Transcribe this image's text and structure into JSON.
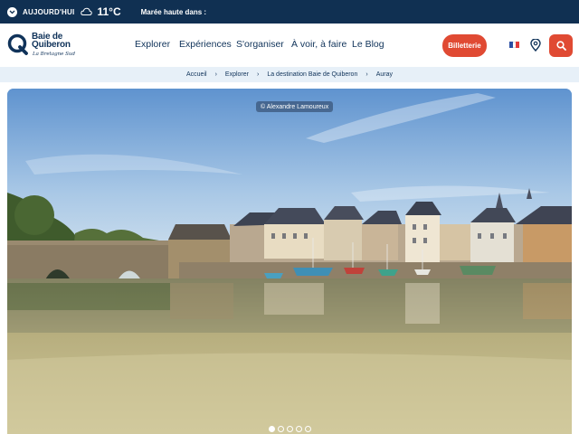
{
  "topbar": {
    "today_label": "AUJOURD'HUI",
    "temperature": "11°C",
    "tide_label": "Marée haute dans :",
    "icons": [
      "chevron-down-icon",
      "cloud-icon"
    ]
  },
  "header": {
    "logo": {
      "line1": "Baie de",
      "line2": "Quiberon",
      "tagline": "La Bretagne Sud"
    },
    "nav": [
      "Explorer",
      "Expériences",
      "S'organiser",
      "À voir, à faire",
      "Le Blog"
    ],
    "ticket_button": "Billetterie",
    "icons": [
      "french-flag-icon",
      "location-pin-icon",
      "search-icon"
    ]
  },
  "breadcrumb": [
    "Accueil",
    "Explorer",
    "La destination Baie de Quiberon",
    "Auray"
  ],
  "hero": {
    "photo_credit": "© Alexandre Lamoureux",
    "slides_count": 5,
    "active_slide": 1
  },
  "colors": {
    "navy": "#103052",
    "accent": "#e04a33",
    "breadcrumb_bg": "#e7f0f8"
  }
}
